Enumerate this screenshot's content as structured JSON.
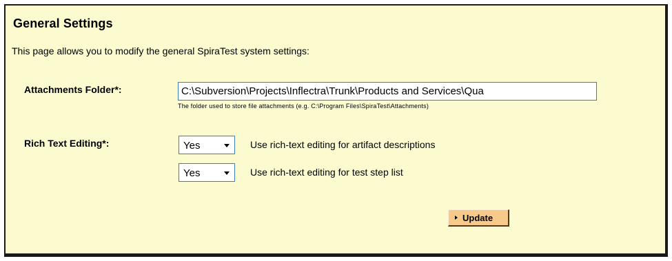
{
  "header": {
    "title": "General Settings",
    "description": "This page allows you to modify the general SpiraTest system settings:"
  },
  "attachments": {
    "label": "Attachments Folder*:",
    "value": "C:\\Subversion\\Projects\\Inflectra\\Trunk\\Products and Services\\Qua",
    "hint": "The folder used to store file attachments (e.g. C:\\Program Files\\SpiraTest\\Attachments)"
  },
  "rich_text": {
    "label": "Rich Text Editing*:",
    "artifact_option": {
      "selected": "Yes",
      "description": "Use rich-text editing for artifact descriptions"
    },
    "test_step_option": {
      "selected": "Yes",
      "description": "Use rich-text editing for test step list"
    }
  },
  "actions": {
    "update_label": "Update"
  },
  "colors": {
    "panel_background": "#fbfbcf",
    "panel_border": "#1a1a1a",
    "input_border": "#3c7fb1",
    "button_background": "#f7c98a"
  },
  "icons": {
    "dropdown": "chevron-down-icon",
    "button": "arrow-right-icon"
  }
}
